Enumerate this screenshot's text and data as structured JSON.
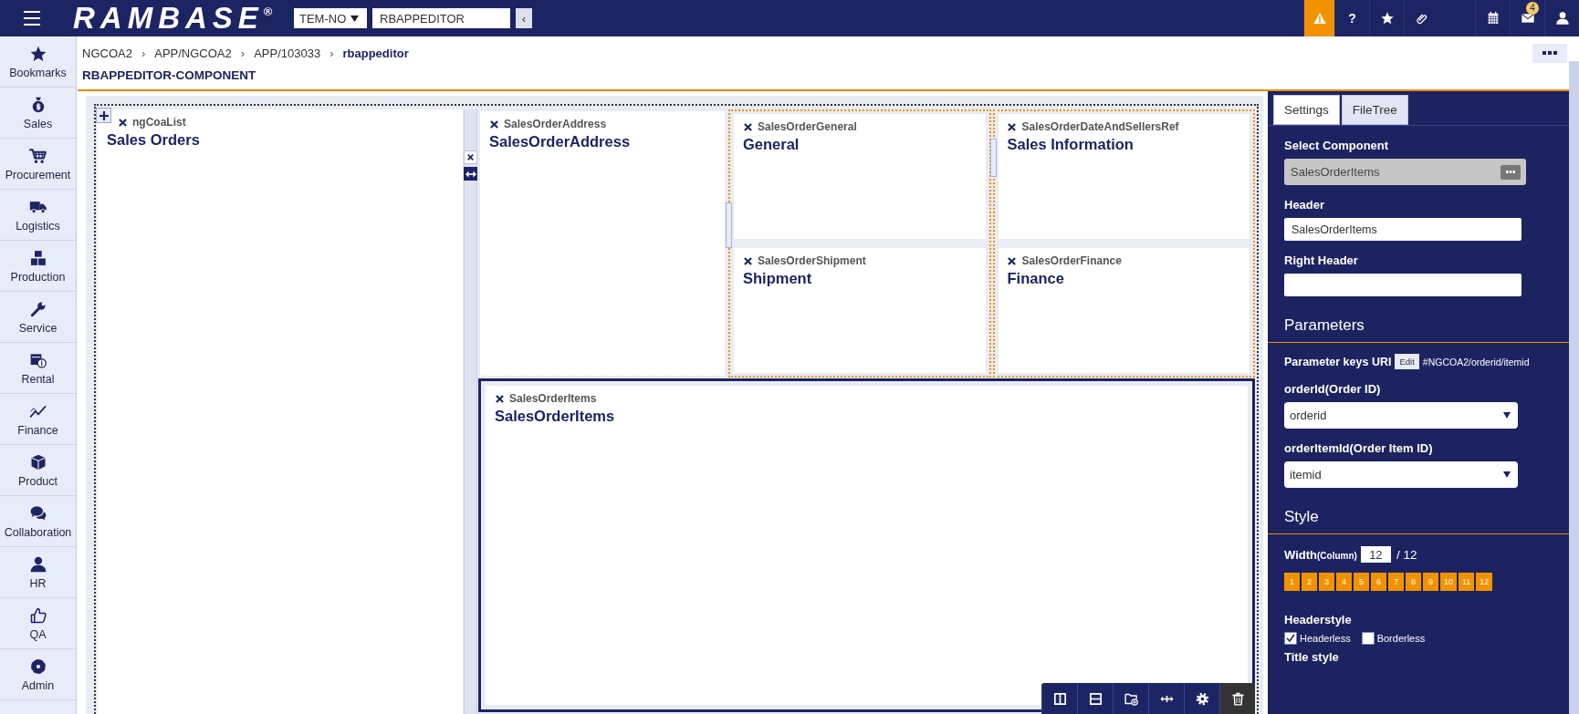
{
  "top_bar": {
    "logo": {
      "text": "RAMBASE",
      "mark": "®"
    },
    "company_select": {
      "value": "TEM-NO"
    },
    "app_field": {
      "value": "RBAPPEDITOR"
    },
    "collapse_button": {
      "label": "‹"
    },
    "action_groups": [
      [
        {
          "highlighted": true
        },
        {
          "label": "?",
          "highlighted": false
        },
        {
          "highlighted": false
        },
        {
          "highlighted": false
        }
      ],
      [
        {
          "highlighted": false
        },
        {
          "highlighted": false,
          "badge": "4"
        },
        {
          "highlighted": false
        }
      ]
    ]
  },
  "sidebar": {
    "items": [
      {
        "label": "Bookmarks"
      },
      {
        "label": "Sales"
      },
      {
        "label": "Procurement"
      },
      {
        "label": "Logistics"
      },
      {
        "label": "Production"
      },
      {
        "label": "Service"
      },
      {
        "label": "Rental"
      },
      {
        "label": "Finance"
      },
      {
        "label": "Product"
      },
      {
        "label": "Collaboration"
      },
      {
        "label": "HR"
      },
      {
        "label": "QA"
      },
      {
        "label": "Admin"
      }
    ]
  },
  "breadcrumb": {
    "separator": "›",
    "items": [
      {
        "label": "NGCOA2",
        "current": false
      },
      {
        "label": "APP/NGCOA2",
        "current": false
      },
      {
        "label": "APP/103033",
        "current": false
      },
      {
        "label": "rbappeditor",
        "current": true
      }
    ]
  },
  "page_title": "RBAPPEDITOR-COMPONENT",
  "canvas": {
    "left": {
      "component": "ngCoaList",
      "header": "Sales Orders",
      "selected": false
    },
    "top_columns": [
      {
        "outlined": false,
        "components": [
          {
            "component": "SalesOrderAddress",
            "header": "SalesOrderAddress",
            "selected": false
          }
        ]
      },
      {
        "outlined": true,
        "components": [
          {
            "component": "SalesOrderGeneral",
            "header": "General",
            "selected": false
          },
          {
            "component": "SalesOrderShipment",
            "header": "Shipment",
            "selected": false
          }
        ]
      },
      {
        "outlined": true,
        "components": [
          {
            "component": "SalesOrderDateAndSellersRef",
            "header": "Sales Information",
            "selected": false
          },
          {
            "component": "SalesOrderFinance",
            "header": "Finance",
            "selected": false
          }
        ]
      }
    ],
    "bottom": {
      "component": "SalesOrderItems",
      "header": "SalesOrderItems",
      "selected": true
    }
  },
  "panel": {
    "tabs": [
      {
        "label": "Settings",
        "selected": true
      },
      {
        "label": "FileTree",
        "selected": false
      }
    ],
    "select_component": {
      "label": "Select Component",
      "value": "SalesOrderItems"
    },
    "header": {
      "label": "Header",
      "value": "SalesOrderItems"
    },
    "right_header": {
      "label": "Right Header"
    },
    "parameters": {
      "title": "Parameters",
      "keys_label": "Parameter keys URI",
      "edit_button": "Edit",
      "keys_value": "#NGCOA2/orderid/itemid",
      "fields": [
        {
          "label": "orderId(Order ID)",
          "value": "orderid"
        },
        {
          "label": "orderItemId(Order Item ID)",
          "value": "itemid"
        }
      ]
    },
    "style": {
      "title": "Style",
      "width_label": "Width",
      "width_unit": "(Column)",
      "width_value": "12",
      "width_total": "/ 12",
      "width_options": [
        "1",
        "2",
        "3",
        "4",
        "5",
        "6",
        "7",
        "8",
        "9",
        "10",
        "11",
        "12"
      ],
      "headerstyle_label": "Headerstyle",
      "checkboxes": [
        {
          "label": "Headerless",
          "checked": true
        },
        {
          "label": "Borderless",
          "checked": false
        }
      ],
      "title_style_label": "Title style"
    }
  }
}
